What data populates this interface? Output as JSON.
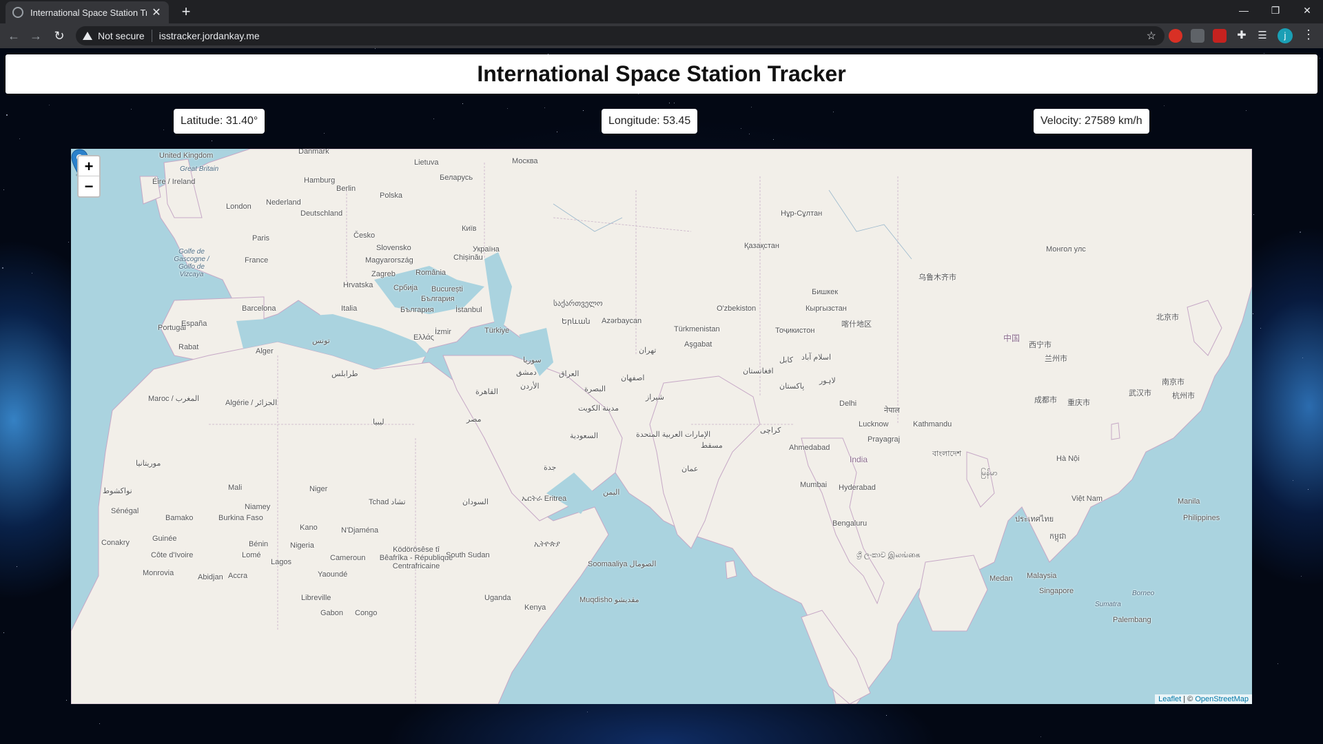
{
  "browser": {
    "tab_title": "International Space Station Track",
    "new_tab": "+",
    "not_secure": "Not secure",
    "url": "isstracker.jordankay.me",
    "profile_initial": "j"
  },
  "page": {
    "title": "International Space Station Tracker",
    "latitude": "Latitude: 31.40°",
    "longitude": "Longitude: 53.45",
    "velocity": "Velocity: 27589 km/h"
  },
  "map": {
    "zoom_in": "+",
    "zoom_out": "−",
    "attribution_leaflet": "Leaflet",
    "attribution_sep": " | © ",
    "attribution_osm": "OpenStreetMap",
    "labels": {
      "uk": "United Kingdom",
      "great_britain": "Great Britain",
      "eire": "Éire / Ireland",
      "danmark": "Danmark",
      "lietuva": "Lietuva",
      "moskva": "Москва",
      "belarus": "Беларусь",
      "hamburg": "Hamburg",
      "berlin": "Berlin",
      "polska": "Polska",
      "nederland": "Nederland",
      "london": "London",
      "deutschland": "Deutschland",
      "kyiv": "Київ",
      "paris": "Paris",
      "cesko": "Česko",
      "slovensko": "Slovensko",
      "ukraina": "Україна",
      "france": "France",
      "magyarorszag": "Magyarország",
      "chisinau": "Chișinău",
      "zagreb": "Zagreb",
      "romania": "România",
      "hrvatska": "Hrvatska",
      "srbija": "Србија",
      "bucuresti": "București",
      "balgariya": "България",
      "italia": "Italia",
      "barcelona": "Barcelona",
      "portugal": "Portugal",
      "espana": "España",
      "istanbul": "İstanbul",
      "turkiye": "Türkiye",
      "izmir": "İzmir",
      "ellas": "Ελλάς",
      "sakartvelo": "საქართველო",
      "erevan": "Երևան",
      "azerbaycan": "Azərbaycan",
      "turkmenistan": "Türkmenistan",
      "asgabat": "Aşgabat",
      "ozbekiston": "O'zbekiston",
      "qazaqstan": "Қазақстан",
      "nursultan": "Нұр-Сұлтан",
      "bishkek": "Бишкек",
      "kyrgyzstan": "Кыргызстан",
      "tojikiston": "Тоҷикистон",
      "kashgar": "喀什地区",
      "urumqi": "乌鲁木齐市",
      "mongol": "Монгол улс",
      "zhongguo": "中国",
      "xining": "西宁市",
      "lanzhou": "兰州市",
      "beijing": "北京市",
      "chengdu": "成都市",
      "chongqing": "重庆市",
      "wuhan": "武汉市",
      "nanjing": "南京市",
      "shanghai_area": "杭州市",
      "tehran": "تهران",
      "isfahan": "اصفهان",
      "shiraz": "شیراز",
      "baghdad": "العراق",
      "basra": "البصرة",
      "kuwait": "مدينة الكويت",
      "suriya": "سوريا",
      "dimashq": "دمشق",
      "urdun": "الأردن",
      "qahira": "القاهرة",
      "misr": "مصر",
      "libya": "ليبيا",
      "saudi": "السعودية",
      "jeddah": "جدة",
      "uae": "الإمارات العربية المتحدة",
      "muscat": "مسقط",
      "oman": "عمان",
      "yemen": "اليمن",
      "afghanistan": "افغانستان",
      "kabul": "کابل",
      "islamabad": "اسلام آباد",
      "pakistan": "پاکستان",
      "lahore": "لاہور",
      "karachi": "کراچی",
      "delhi": "Delhi",
      "nepal": "नेपाल",
      "kathmandu": "Kathmandu",
      "lucknow": "Lucknow",
      "prayagraj": "Prayagraj",
      "ahmedabad": "Ahmedabad",
      "india": "India",
      "mumbai": "Mumbai",
      "hyderabad": "Hyderabad",
      "bengaluru": "Bengaluru",
      "srilanka": "ශ්‍රී ලංකාව இலங்கை",
      "bangladesh": "বাংলাদেশ",
      "myanmar": "မြန်မာ",
      "hanoi": "Hà Nội",
      "vietnam": "Việt Nam",
      "thailand": "ประเทศไทย",
      "cambodia": "កម្ពុជា",
      "malaysia": "Malaysia",
      "singapore": "Singapore",
      "medan": "Medan",
      "manila": "Manila",
      "philippines": "Philippines",
      "borneo": "Borneo",
      "sumatra": "Sumatra",
      "palembang": "Palembang",
      "rabat": "Rabat",
      "alger": "Alger",
      "tunis": "تونس",
      "tarabulus": "طرابلس",
      "maroc": "Maroc / المغرب",
      "algerie": "Algérie / الجزائر",
      "mauritanie": "موريتانيا",
      "nouakchott": "نواكشوط",
      "senegal": "Sénégal",
      "mali": "Mali",
      "niger": "Niger",
      "tchad": "Tchad تشاد",
      "sudan": "السودان",
      "eritrea": "ኤርትራ Eritrea",
      "ethiopia": "ኢትዮጵያ",
      "bamako": "Bamako",
      "niamey": "Niamey",
      "burkina": "Burkina Faso",
      "guinee": "Guinée",
      "conakry": "Conakry",
      "benin": "Bénin",
      "nigeria": "Nigeria",
      "kano": "Kano",
      "ndjamena": "N'Djaména",
      "cameroun": "Cameroun",
      "centrafrique": "Ködörösêse tî Bêafrîka - République Centrafricaine",
      "southsudan": "South Sudan",
      "somalia": "Soomaaliya الصومال",
      "cotedivoire": "Côte d'Ivoire",
      "monrovia": "Monrovia",
      "abidjan": "Abidjan",
      "accra": "Accra",
      "lome": "Lomé",
      "lagos": "Lagos",
      "yaounde": "Yaoundé",
      "libreville": "Libreville",
      "gabon": "Gabon",
      "congo": "Congo",
      "uganda": "Uganda",
      "kenya": "Kenya",
      "mogadishu": "Muqdisho مقديشو",
      "gascogne": "Golfe de Gascogne / Golfo de Vizcaya"
    }
  }
}
